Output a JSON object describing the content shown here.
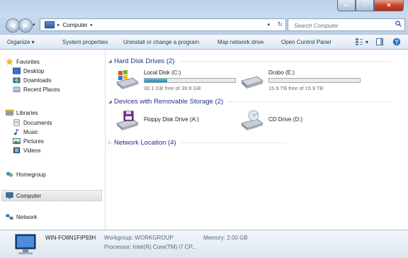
{
  "window": {
    "buttons": {
      "minimize": "—",
      "maximize": "□",
      "close": "✕"
    }
  },
  "navigation": {
    "breadcrumb_separator": "▸",
    "address": "Computer",
    "search_placeholder": "Search Computer",
    "refresh_glyph": "↻"
  },
  "toolbar": {
    "organize": "Organize ▾",
    "system_properties": "System properties",
    "uninstall": "Uninstall or change a program",
    "map_drive": "Map network drive",
    "control_panel": "Open Control Panel",
    "view_dropdown": "▾"
  },
  "sidebar": {
    "favorites": "Favorites",
    "desktop": "Desktop",
    "downloads": "Downloads",
    "recent_places": "Recent Places",
    "libraries": "Libraries",
    "documents": "Documents",
    "music": "Music",
    "pictures": "Pictures",
    "videos": "Videos",
    "homegroup": "Homegroup",
    "computer": "Computer",
    "network": "Network"
  },
  "groups": {
    "hard_disk": "Hard Disk Drives (2)",
    "removable": "Devices with Removable Storage (2)",
    "network": "Network Location (4)",
    "expanded_glyph": "◢",
    "collapsed_glyph": "▷"
  },
  "drives": {
    "local_c": {
      "name": "Local Disk (C:)",
      "free": "30.1 GB free of 39.9 GB",
      "used_fraction": 0.25
    },
    "drobo_e": {
      "name": "Drobo (E:)",
      "free": "15.9 TB free of 15.9 TB",
      "used_fraction": 0.0
    },
    "floppy_a": {
      "name": "Floppy Disk Drive (A:)"
    },
    "cd_d": {
      "name": "CD Drive (D:)"
    }
  },
  "status": {
    "computer_name": "WIN-FO6N1FIP93H",
    "workgroup": "Workgroup: WORKGROUP",
    "memory": "Memory: 2.00 GB",
    "processor": "Processor: Intel(R) Core(TM) i7 CP..."
  },
  "colors": {
    "accent": "#1e3287",
    "titlebar": "#b9d1ea",
    "drive_fill": "#2a9fd6"
  }
}
